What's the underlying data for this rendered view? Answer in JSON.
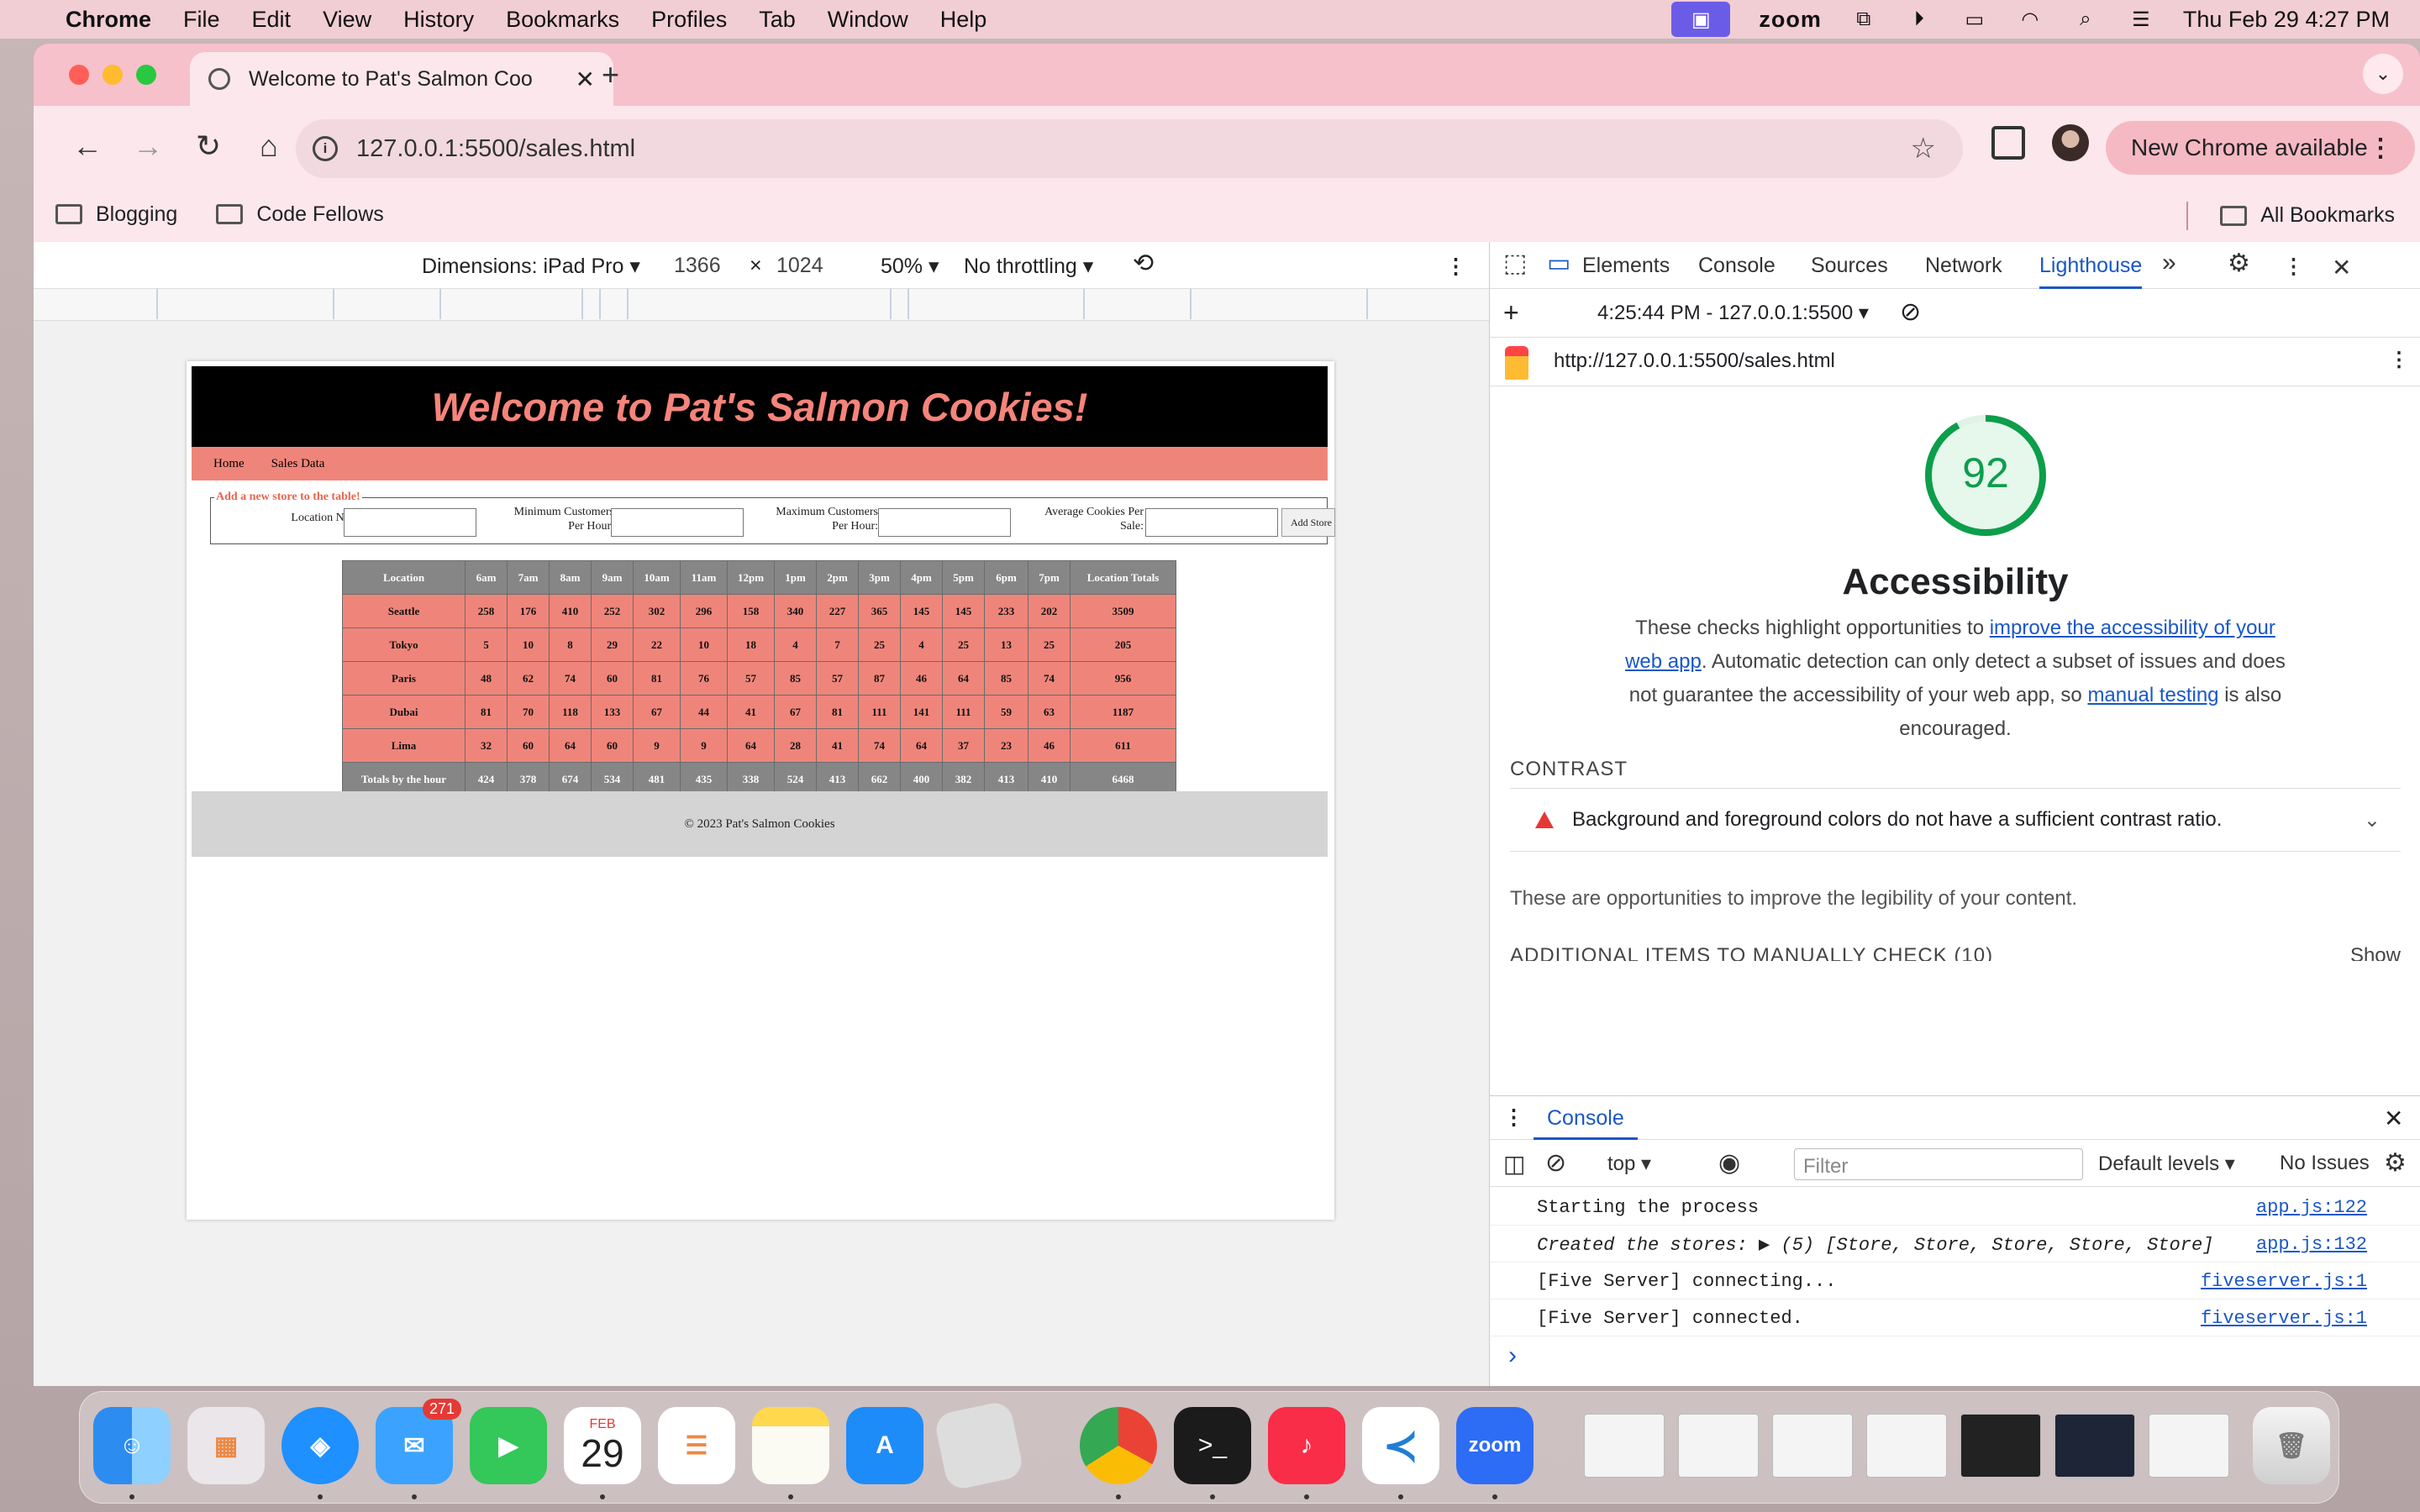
{
  "menubar": {
    "app": "Chrome",
    "items": [
      "File",
      "Edit",
      "View",
      "History",
      "Bookmarks",
      "Profiles",
      "Tab",
      "Window",
      "Help"
    ],
    "zoom_label": "zoom",
    "clock": "Thu Feb 29  4:27 PM"
  },
  "tab": {
    "title": "Welcome to Pat's Salmon Coo",
    "close": "✕",
    "new": "+"
  },
  "toolbar": {
    "url": "127.0.0.1:5500/sales.html",
    "new_chrome": "New Chrome available"
  },
  "bookmarks": {
    "items": [
      "Blogging",
      "Code Fellows"
    ],
    "all": "All Bookmarks"
  },
  "device_bar": {
    "dimensions": "Dimensions: iPad Pro ▾",
    "width": "1366",
    "x": "×",
    "height": "1024",
    "zoom": "50% ▾",
    "throttling": "No throttling ▾"
  },
  "page": {
    "title": "Welcome to Pat's Salmon Cookies!",
    "nav": [
      "Home",
      "Sales Data"
    ],
    "form": {
      "legend": "Add a new store to the table!",
      "location_label": "Location Name:",
      "min_label_1": "Minimum Customers",
      "min_label_2": "Per Hour:",
      "max_label_1": "Maximum Customers",
      "max_label_2": "Per Hour:",
      "avg_label_1": "Average Cookies Per",
      "avg_label_2": "Sale:",
      "add_button": "Add Store"
    },
    "table": {
      "headers": [
        "Location",
        "6am",
        "7am",
        "8am",
        "9am",
        "10am",
        "11am",
        "12pm",
        "1pm",
        "2pm",
        "3pm",
        "4pm",
        "5pm",
        "6pm",
        "7pm",
        "Location Totals"
      ],
      "rows": [
        [
          "Seattle",
          "258",
          "176",
          "410",
          "252",
          "302",
          "296",
          "158",
          "340",
          "227",
          "365",
          "145",
          "145",
          "233",
          "202",
          "3509"
        ],
        [
          "Tokyo",
          "5",
          "10",
          "8",
          "29",
          "22",
          "10",
          "18",
          "4",
          "7",
          "25",
          "4",
          "25",
          "13",
          "25",
          "205"
        ],
        [
          "Paris",
          "48",
          "62",
          "74",
          "60",
          "81",
          "76",
          "57",
          "85",
          "57",
          "87",
          "46",
          "64",
          "85",
          "74",
          "956"
        ],
        [
          "Dubai",
          "81",
          "70",
          "118",
          "133",
          "67",
          "44",
          "41",
          "67",
          "81",
          "111",
          "141",
          "111",
          "59",
          "63",
          "1187"
        ],
        [
          "Lima",
          "32",
          "60",
          "64",
          "60",
          "9",
          "9",
          "64",
          "28",
          "41",
          "74",
          "64",
          "37",
          "23",
          "46",
          "611"
        ]
      ],
      "totals": [
        "Totals by the hour",
        "424",
        "378",
        "674",
        "534",
        "481",
        "435",
        "338",
        "524",
        "413",
        "662",
        "400",
        "382",
        "413",
        "410",
        "6468"
      ]
    },
    "footer": "© 2023 Pat's Salmon Cookies"
  },
  "devtools": {
    "tabs": [
      "Elements",
      "Console",
      "Sources",
      "Network",
      "Lighthouse"
    ],
    "active_tab": "Lighthouse",
    "report_time": "4:25:44 PM - 127.0.0.1:5500 ▾",
    "report_url": "http://127.0.0.1:5500/sales.html",
    "score": "92",
    "score_value": 0.92,
    "score_color": "#0c9e4a",
    "category": "Accessibility",
    "desc_1": "These checks highlight opportunities to ",
    "desc_link_1": "improve the accessibility of your web app",
    "desc_2": ". Automatic detection can only detect a subset of issues and does not guarantee the accessibility of your web app, so ",
    "desc_link_2": "manual testing",
    "desc_3": " is also encouraged.",
    "contrast_heading": "CONTRAST",
    "contrast_item": "Background and foreground colors do not have a sufficient contrast ratio.",
    "opportunities": "These are opportunities to improve the legibility of your content.",
    "additional": "ADDITIONAL ITEMS TO MANUALLY CHECK (10)",
    "show": "Show"
  },
  "console": {
    "tab": "Console",
    "context": "top ▾",
    "filter_placeholder": "Filter",
    "levels": "Default levels ▾",
    "issues": "No Issues",
    "logs": [
      {
        "msg": "Starting the process",
        "src": "app.js:122"
      },
      {
        "msg": "Created the stores:  ▶ (5) [Store, Store, Store, Store, Store]",
        "src": "app.js:132"
      },
      {
        "msg": "[Five Server] connecting...",
        "src": "fiveserver.js:1"
      },
      {
        "msg": "[Five Server] connected.",
        "src": "fiveserver.js:1"
      }
    ],
    "prompt": "›"
  },
  "dock": {
    "mail_badge": "271",
    "calendar_month": "FEB",
    "calendar_day": "29",
    "zoom": "zoom",
    "terminal": ">_"
  }
}
